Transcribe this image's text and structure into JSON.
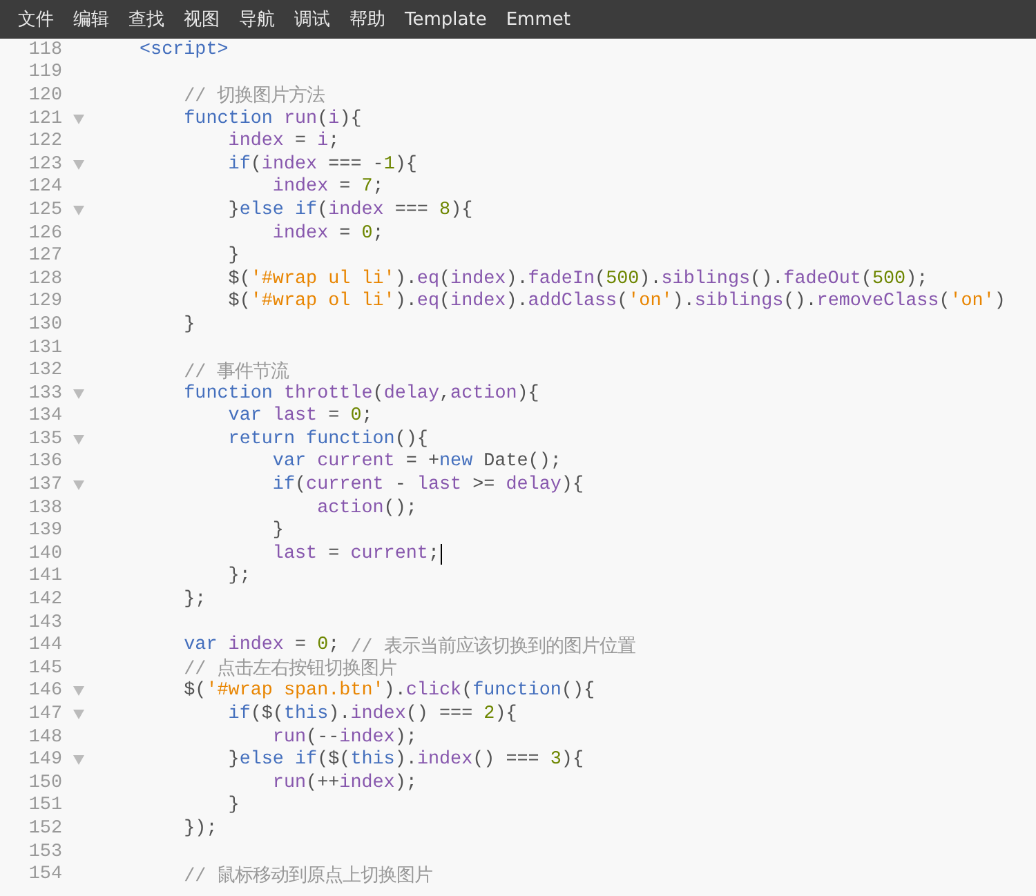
{
  "menu_bar": {
    "items": [
      "文件",
      "编辑",
      "查找",
      "视图",
      "导航",
      "调试",
      "帮助",
      "Template",
      "Emmet"
    ]
  },
  "editor": {
    "lines": [
      {
        "number": "118",
        "fold": false,
        "tokens": [
          {
            "kind": "tag",
            "text": "<script>"
          }
        ]
      },
      {
        "number": "119",
        "fold": false
      },
      {
        "number": "120",
        "fold": false,
        "tokens": [
          {
            "kind": "comment",
            "text": "    // 切换图片方法"
          }
        ]
      },
      {
        "number": "121",
        "fold": true,
        "tokens": [
          {
            "kind": "keyword",
            "text": "    function"
          },
          {
            "kind": "name",
            "text": " run"
          },
          {
            "kind": "plain",
            "text": "("
          },
          {
            "kind": "name",
            "text": "i"
          },
          {
            "kind": "plain",
            "text": "){"
          }
        ]
      },
      {
        "number": "122",
        "fold": false,
        "tokens": [
          {
            "kind": "name",
            "text": "        index"
          },
          {
            "kind": "plain",
            "text": " = "
          },
          {
            "kind": "name",
            "text": "i"
          },
          {
            "kind": "plain",
            "text": ";"
          }
        ]
      },
      {
        "number": "123",
        "fold": true,
        "tokens": [
          {
            "kind": "keyword",
            "text": "        if"
          },
          {
            "kind": "plain",
            "text": "("
          },
          {
            "kind": "name",
            "text": "index"
          },
          {
            "kind": "plain",
            "text": " === -"
          },
          {
            "kind": "number",
            "text": "1"
          },
          {
            "kind": "plain",
            "text": "){"
          }
        ]
      },
      {
        "number": "124",
        "fold": false,
        "tokens": [
          {
            "kind": "name",
            "text": "            index"
          },
          {
            "kind": "plain",
            "text": " = "
          },
          {
            "kind": "number",
            "text": "7"
          },
          {
            "kind": "plain",
            "text": ";"
          }
        ]
      },
      {
        "number": "125",
        "fold": true,
        "tokens": [
          {
            "kind": "plain",
            "text": "        }"
          },
          {
            "kind": "keyword",
            "text": "else"
          },
          {
            "kind": "keyword",
            "text": " if"
          },
          {
            "kind": "plain",
            "text": "("
          },
          {
            "kind": "name",
            "text": "index"
          },
          {
            "kind": "plain",
            "text": " === "
          },
          {
            "kind": "number",
            "text": "8"
          },
          {
            "kind": "plain",
            "text": "){"
          }
        ]
      },
      {
        "number": "126",
        "fold": false,
        "tokens": [
          {
            "kind": "name",
            "text": "            index"
          },
          {
            "kind": "plain",
            "text": " = "
          },
          {
            "kind": "number",
            "text": "0"
          },
          {
            "kind": "plain",
            "text": ";"
          }
        ]
      },
      {
        "number": "127",
        "fold": false,
        "tokens": [
          {
            "kind": "plain",
            "text": "        }"
          }
        ]
      },
      {
        "number": "128",
        "fold": false,
        "tokens": [
          {
            "kind": "plain",
            "text": "        $("
          },
          {
            "kind": "string",
            "text": "'#wrap ul li'"
          },
          {
            "kind": "plain",
            "text": ")."
          },
          {
            "kind": "name",
            "text": "eq"
          },
          {
            "kind": "plain",
            "text": "("
          },
          {
            "kind": "name",
            "text": "index"
          },
          {
            "kind": "plain",
            "text": ")."
          },
          {
            "kind": "name",
            "text": "fadeIn"
          },
          {
            "kind": "plain",
            "text": "("
          },
          {
            "kind": "number",
            "text": "500"
          },
          {
            "kind": "plain",
            "text": ")."
          },
          {
            "kind": "name",
            "text": "siblings"
          },
          {
            "kind": "plain",
            "text": "()."
          },
          {
            "kind": "name",
            "text": "fadeOut"
          },
          {
            "kind": "plain",
            "text": "("
          },
          {
            "kind": "number",
            "text": "500"
          },
          {
            "kind": "plain",
            "text": ");"
          }
        ]
      },
      {
        "number": "129",
        "fold": false,
        "tokens": [
          {
            "kind": "plain",
            "text": "        $("
          },
          {
            "kind": "string",
            "text": "'#wrap ol li'"
          },
          {
            "kind": "plain",
            "text": ")."
          },
          {
            "kind": "name",
            "text": "eq"
          },
          {
            "kind": "plain",
            "text": "("
          },
          {
            "kind": "name",
            "text": "index"
          },
          {
            "kind": "plain",
            "text": ")."
          },
          {
            "kind": "name",
            "text": "addClass"
          },
          {
            "kind": "plain",
            "text": "("
          },
          {
            "kind": "string",
            "text": "'on'"
          },
          {
            "kind": "plain",
            "text": ")."
          },
          {
            "kind": "name",
            "text": "siblings"
          },
          {
            "kind": "plain",
            "text": "()."
          },
          {
            "kind": "name",
            "text": "removeClass"
          },
          {
            "kind": "plain",
            "text": "("
          },
          {
            "kind": "string",
            "text": "'on'"
          },
          {
            "kind": "plain",
            "text": ")"
          }
        ]
      },
      {
        "number": "130",
        "fold": false,
        "tokens": [
          {
            "kind": "plain",
            "text": "    }"
          }
        ]
      },
      {
        "number": "131",
        "fold": false
      },
      {
        "number": "132",
        "fold": false,
        "tokens": [
          {
            "kind": "comment",
            "text": "    // 事件节流"
          }
        ]
      },
      {
        "number": "133",
        "fold": true,
        "tokens": [
          {
            "kind": "keyword",
            "text": "    function"
          },
          {
            "kind": "name",
            "text": " throttle"
          },
          {
            "kind": "plain",
            "text": "("
          },
          {
            "kind": "name",
            "text": "delay"
          },
          {
            "kind": "plain",
            "text": ","
          },
          {
            "kind": "name",
            "text": "action"
          },
          {
            "kind": "plain",
            "text": "){"
          }
        ]
      },
      {
        "number": "134",
        "fold": false,
        "tokens": [
          {
            "kind": "keyword",
            "text": "        var"
          },
          {
            "kind": "name",
            "text": " last"
          },
          {
            "kind": "plain",
            "text": " = "
          },
          {
            "kind": "number",
            "text": "0"
          },
          {
            "kind": "plain",
            "text": ";"
          }
        ]
      },
      {
        "number": "135",
        "fold": true,
        "tokens": [
          {
            "kind": "keyword",
            "text": "        return"
          },
          {
            "kind": "keyword",
            "text": " function"
          },
          {
            "kind": "plain",
            "text": "(){"
          }
        ]
      },
      {
        "number": "136",
        "fold": false,
        "tokens": [
          {
            "kind": "keyword",
            "text": "            var"
          },
          {
            "kind": "name",
            "text": " current"
          },
          {
            "kind": "plain",
            "text": " = +"
          },
          {
            "kind": "keyword",
            "text": "new"
          },
          {
            "kind": "plain",
            "text": " Date();"
          }
        ]
      },
      {
        "number": "137",
        "fold": true,
        "tokens": [
          {
            "kind": "keyword",
            "text": "            if"
          },
          {
            "kind": "plain",
            "text": "("
          },
          {
            "kind": "name",
            "text": "current"
          },
          {
            "kind": "plain",
            "text": " - "
          },
          {
            "kind": "name",
            "text": "last"
          },
          {
            "kind": "plain",
            "text": " >= "
          },
          {
            "kind": "name",
            "text": "delay"
          },
          {
            "kind": "plain",
            "text": "){"
          }
        ]
      },
      {
        "number": "138",
        "fold": false,
        "tokens": [
          {
            "kind": "name",
            "text": "                action"
          },
          {
            "kind": "plain",
            "text": "();"
          }
        ]
      },
      {
        "number": "139",
        "fold": false,
        "tokens": [
          {
            "kind": "plain",
            "text": "            }"
          }
        ]
      },
      {
        "number": "140",
        "fold": false,
        "caret": true,
        "tokens": [
          {
            "kind": "name",
            "text": "            last"
          },
          {
            "kind": "plain",
            "text": " = "
          },
          {
            "kind": "name",
            "text": "current"
          },
          {
            "kind": "plain",
            "text": ";"
          }
        ]
      },
      {
        "number": "141",
        "fold": false,
        "tokens": [
          {
            "kind": "plain",
            "text": "        };"
          }
        ]
      },
      {
        "number": "142",
        "fold": false,
        "tokens": [
          {
            "kind": "plain",
            "text": "    };"
          }
        ]
      },
      {
        "number": "143",
        "fold": false
      },
      {
        "number": "144",
        "fold": false,
        "tokens": [
          {
            "kind": "keyword",
            "text": "    var"
          },
          {
            "kind": "name",
            "text": " index"
          },
          {
            "kind": "plain",
            "text": " = "
          },
          {
            "kind": "number",
            "text": "0"
          },
          {
            "kind": "plain",
            "text": ";"
          },
          {
            "kind": "comment",
            "text": " // 表示当前应该切换到的图片位置"
          }
        ]
      },
      {
        "number": "145",
        "fold": false,
        "tokens": [
          {
            "kind": "comment",
            "text": "    // 点击左右按钮切换图片"
          }
        ]
      },
      {
        "number": "146",
        "fold": true,
        "tokens": [
          {
            "kind": "plain",
            "text": "    $("
          },
          {
            "kind": "string",
            "text": "'#wrap span.btn'"
          },
          {
            "kind": "plain",
            "text": ")."
          },
          {
            "kind": "name",
            "text": "click"
          },
          {
            "kind": "plain",
            "text": "("
          },
          {
            "kind": "keyword",
            "text": "function"
          },
          {
            "kind": "plain",
            "text": "(){"
          }
        ]
      },
      {
        "number": "147",
        "fold": true,
        "tokens": [
          {
            "kind": "keyword",
            "text": "        if"
          },
          {
            "kind": "plain",
            "text": "($("
          },
          {
            "kind": "keyword",
            "text": "this"
          },
          {
            "kind": "plain",
            "text": ")."
          },
          {
            "kind": "name",
            "text": "index"
          },
          {
            "kind": "plain",
            "text": "() === "
          },
          {
            "kind": "number",
            "text": "2"
          },
          {
            "kind": "plain",
            "text": "){"
          }
        ]
      },
      {
        "number": "148",
        "fold": false,
        "tokens": [
          {
            "kind": "name",
            "text": "            run"
          },
          {
            "kind": "plain",
            "text": "(--"
          },
          {
            "kind": "name",
            "text": "index"
          },
          {
            "kind": "plain",
            "text": ");"
          }
        ]
      },
      {
        "number": "149",
        "fold": true,
        "tokens": [
          {
            "kind": "plain",
            "text": "        }"
          },
          {
            "kind": "keyword",
            "text": "else"
          },
          {
            "kind": "keyword",
            "text": " if"
          },
          {
            "kind": "plain",
            "text": "($("
          },
          {
            "kind": "keyword",
            "text": "this"
          },
          {
            "kind": "plain",
            "text": ")."
          },
          {
            "kind": "name",
            "text": "index"
          },
          {
            "kind": "plain",
            "text": "() === "
          },
          {
            "kind": "number",
            "text": "3"
          },
          {
            "kind": "plain",
            "text": "){"
          }
        ]
      },
      {
        "number": "150",
        "fold": false,
        "tokens": [
          {
            "kind": "name",
            "text": "            run"
          },
          {
            "kind": "plain",
            "text": "(++"
          },
          {
            "kind": "name",
            "text": "index"
          },
          {
            "kind": "plain",
            "text": ");"
          }
        ]
      },
      {
        "number": "151",
        "fold": false,
        "tokens": [
          {
            "kind": "plain",
            "text": "        }"
          }
        ]
      },
      {
        "number": "152",
        "fold": false,
        "tokens": [
          {
            "kind": "plain",
            "text": "    });"
          }
        ]
      },
      {
        "number": "153",
        "fold": false
      },
      {
        "number": "154",
        "fold": false,
        "tokens": [
          {
            "kind": "comment",
            "text": "    // 鼠标移动到原点上切换图片"
          }
        ]
      }
    ]
  }
}
